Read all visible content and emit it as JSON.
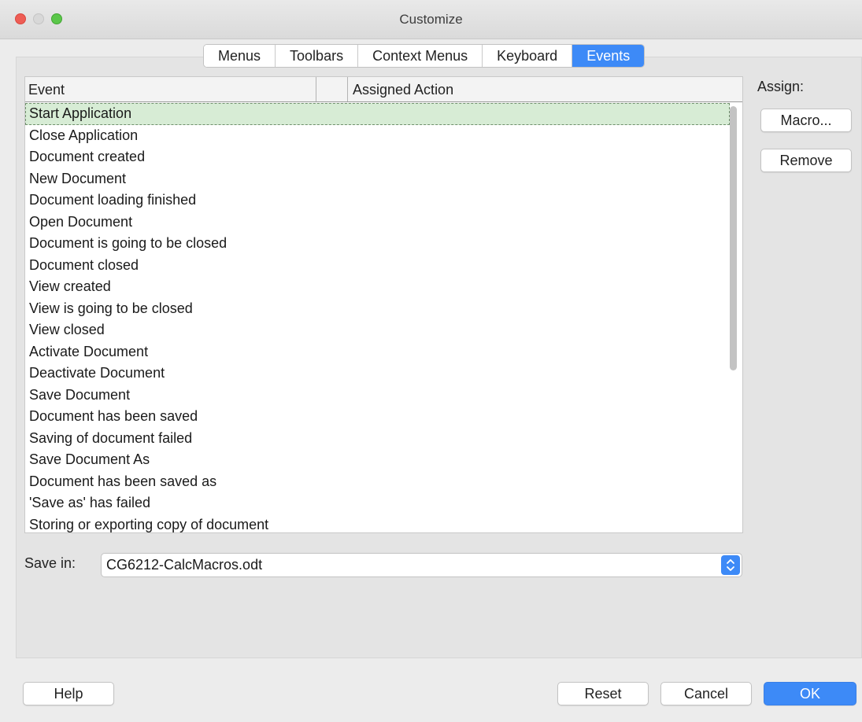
{
  "window": {
    "title": "Customize"
  },
  "tabs": [
    {
      "label": "Menus"
    },
    {
      "label": "Toolbars"
    },
    {
      "label": "Context Menus"
    },
    {
      "label": "Keyboard"
    },
    {
      "label": "Events",
      "active": true
    }
  ],
  "list": {
    "columns": {
      "event": "Event",
      "middle": "",
      "action": "Assigned Action"
    },
    "selected_index": 0,
    "rows": [
      "Start Application",
      "Close Application",
      "Document created",
      "New Document",
      "Document loading finished",
      "Open Document",
      "Document is going to be closed",
      "Document closed",
      "View created",
      "View is going to be closed",
      "View closed",
      "Activate Document",
      "Deactivate Document",
      "Save Document",
      "Document has been saved",
      "Saving of document failed",
      "Save Document As",
      "Document has been saved as",
      "'Save as' has failed",
      "Storing or exporting copy of document"
    ]
  },
  "assign": {
    "label": "Assign:",
    "macro_button": "Macro...",
    "remove_button": "Remove"
  },
  "save_in": {
    "label": "Save in:",
    "value": "CG6212-CalcMacros.odt"
  },
  "footer": {
    "help": "Help",
    "reset": "Reset",
    "cancel": "Cancel",
    "ok": "OK"
  },
  "colors": {
    "accent": "#3d8af7",
    "selection": "#d7ecd5",
    "close": "#ee5d55",
    "maximize": "#5bc74a"
  }
}
